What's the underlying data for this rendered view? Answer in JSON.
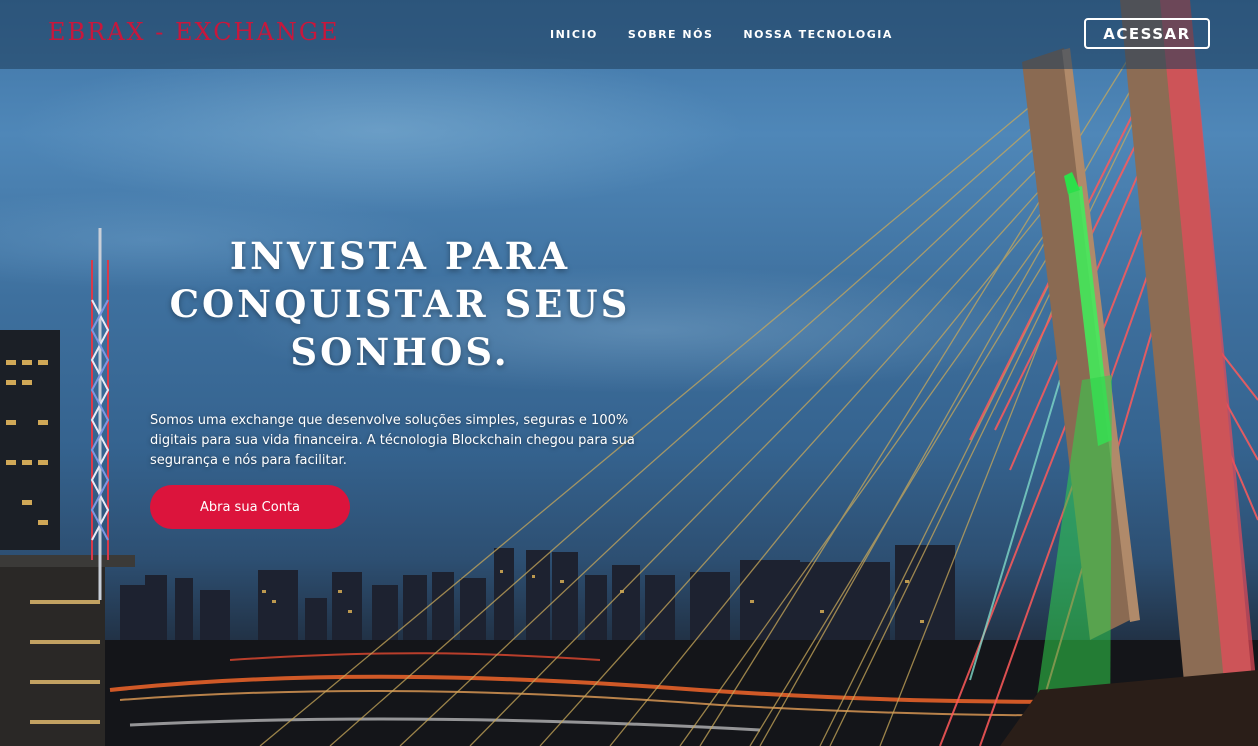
{
  "nav": {
    "brand": "EBRAX - EXCHANGE",
    "links": [
      {
        "label": "INICIO"
      },
      {
        "label": "SOBRE NÓS"
      },
      {
        "label": "NOSSA TECNOLOGIA"
      }
    ],
    "login_label": "ACESSAR"
  },
  "hero": {
    "headline": "INVISTA PARA CONQUISTAR SEUS SONHOS.",
    "description": "Somos uma exchange que desenvolve soluções simples, seguras e 100% digitais para sua vida financeira. A técnologia Blockchain chegou para sua segurança e nós para facilitar.",
    "cta_label": "Abra sua Conta"
  },
  "colors": {
    "brand": "#c8173c",
    "cta": "#dc143c",
    "nav_bg": "#1e3c5a"
  },
  "background": {
    "description_icons": [
      "city-skyline",
      "cable-stayed-bridge",
      "radio-tower"
    ]
  }
}
